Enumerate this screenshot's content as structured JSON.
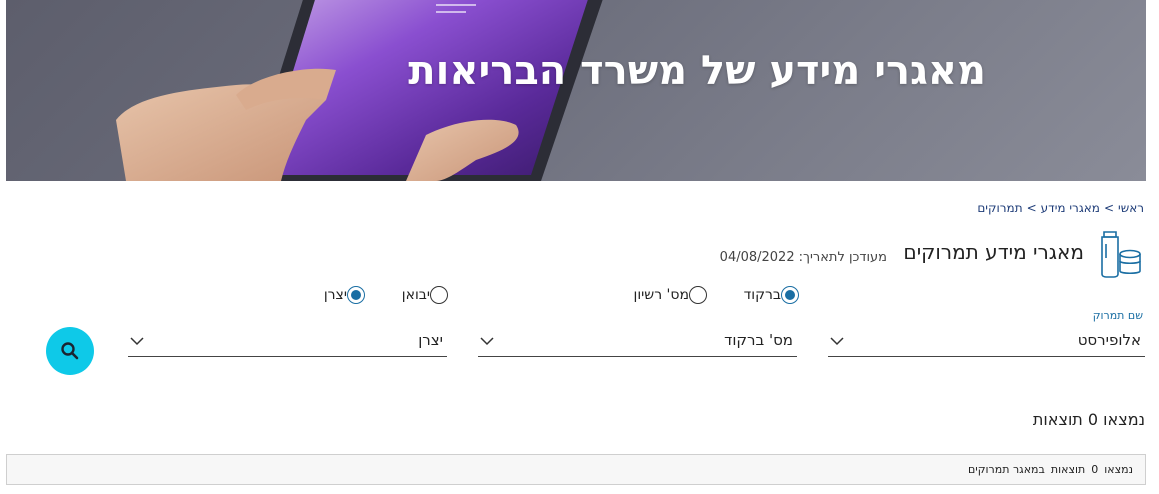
{
  "hero": {
    "title": "מאגרי מידע של משרד הבריאות"
  },
  "breadcrumb": {
    "items": [
      "ראשי",
      "מאגרי מידע",
      "תמרוקים"
    ],
    "separator": ">"
  },
  "header": {
    "title": "מאגרי מידע תמרוקים",
    "updated_label": "מעודכן לתאריך:",
    "updated_date": "04/08/2022",
    "icon": "cosmetics-jars-icon"
  },
  "search": {
    "type_options": [
      {
        "label": "ברקוד",
        "checked": true
      },
      {
        "label": "מס' רשיון",
        "checked": false
      }
    ],
    "source_options": [
      {
        "label": "יבואן",
        "checked": false
      },
      {
        "label": "יצרן",
        "checked": true
      }
    ],
    "product_field": {
      "caption": "שם תמרוק",
      "value": "אלופירסט"
    },
    "barcode_field": {
      "value": "מס' ברקוד"
    },
    "manufacturer_field": {
      "value": "יצרן"
    },
    "button_icon": "search-icon"
  },
  "results": {
    "heading": "נמצאו 0 תוצאות",
    "note": {
      "found": "נמצאו",
      "count": "0",
      "results": "תוצאות",
      "context": "במאגר תמרוקים"
    }
  },
  "colors": {
    "accent": "#1a6ea3",
    "search_button": "#0ec9e8",
    "breadcrumb": "#1e3c78"
  }
}
